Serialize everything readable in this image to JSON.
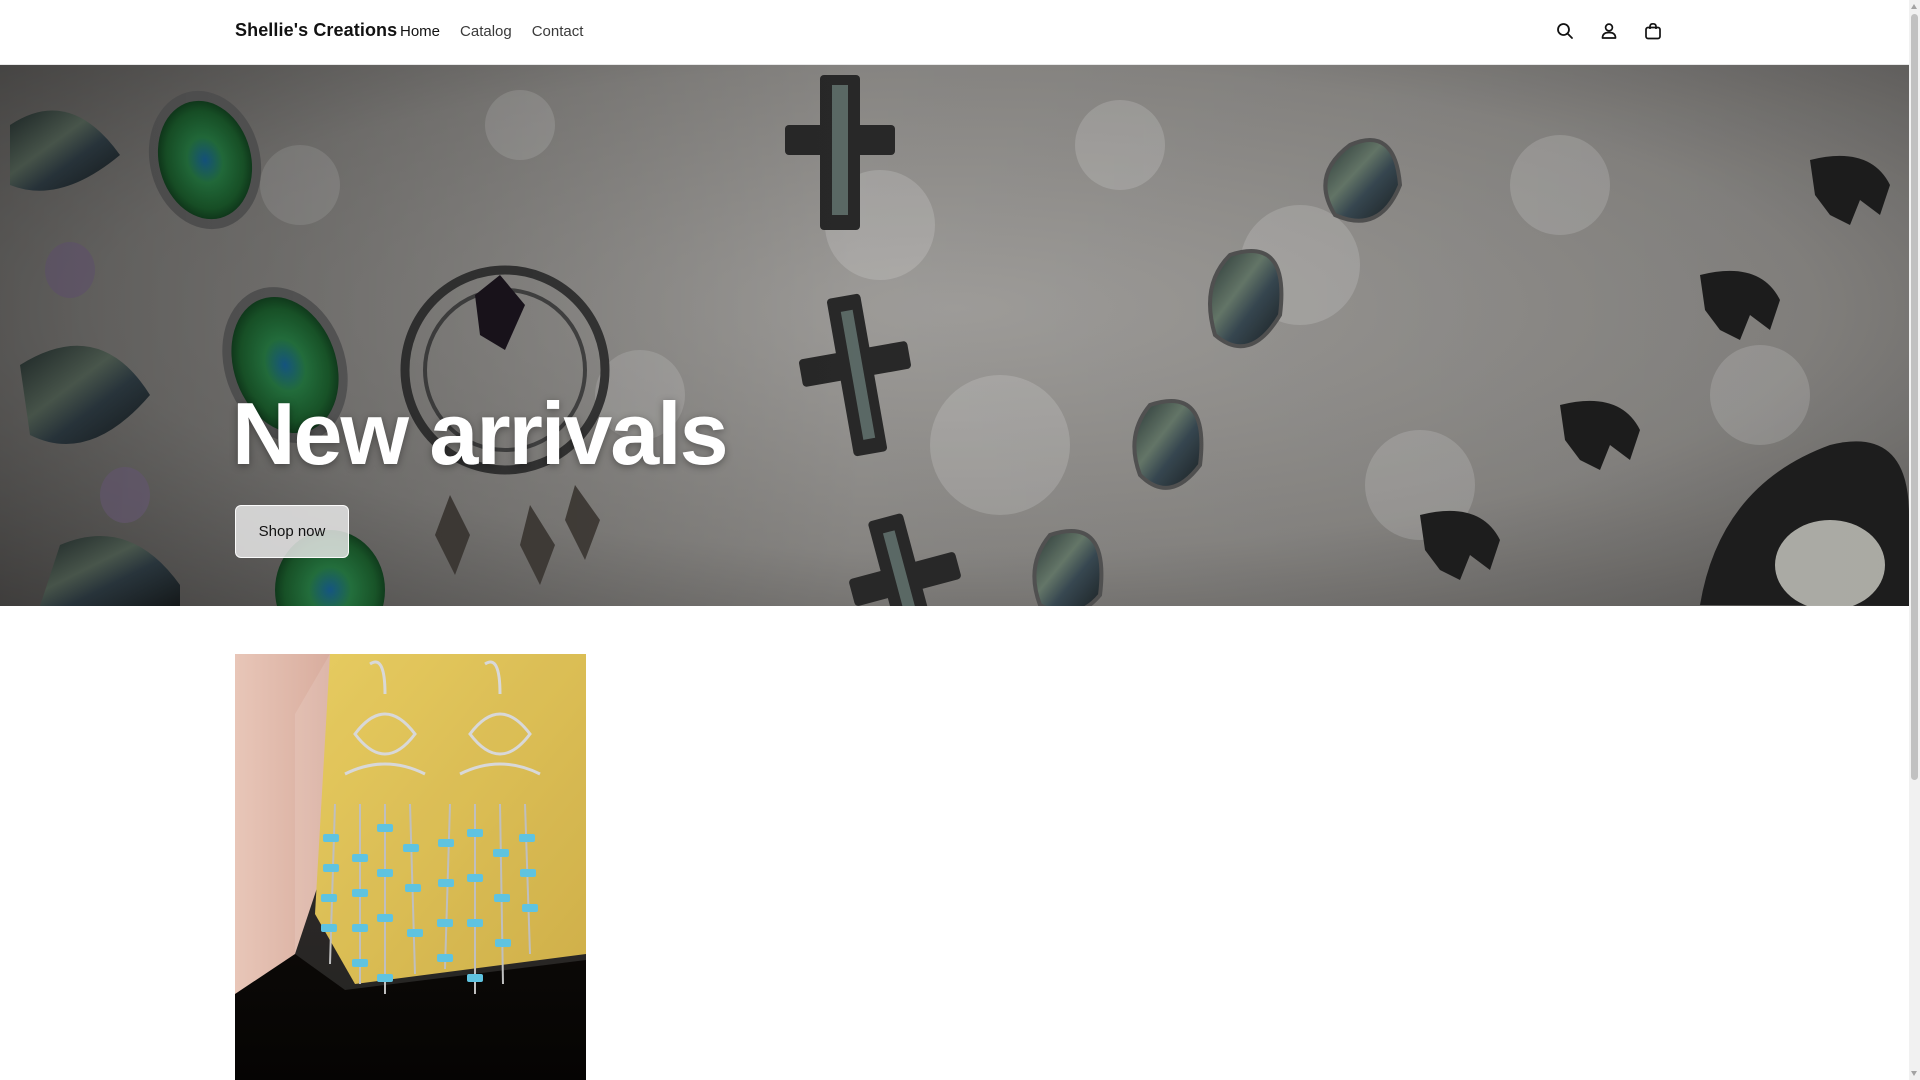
{
  "header": {
    "brand": "Shellie's Creations",
    "nav": [
      {
        "label": "Home"
      },
      {
        "label": "Catalog"
      },
      {
        "label": "Contact"
      }
    ],
    "icons": [
      "search-icon",
      "account-icon",
      "cart-icon"
    ]
  },
  "hero": {
    "title": "New arrivals",
    "button_label": "Shop now"
  },
  "colors": {
    "text": "#121212",
    "hero_text": "#ffffff",
    "button_bg": "#ebebeb"
  }
}
